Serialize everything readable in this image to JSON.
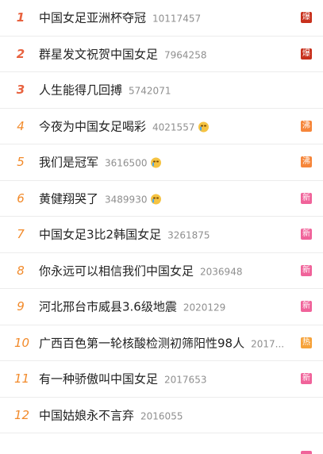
{
  "colors": {
    "top_rank": "#e8623f",
    "rank": "#f28a2a",
    "badge_bao": "#c8311d",
    "badge_fei": "#f6863a",
    "badge_xin": "#f0639a",
    "badge_re": "#f6a23a"
  },
  "items": [
    {
      "rank": "1",
      "title": "中国女足亚洲杯夺冠",
      "count": "10117457",
      "emoji": false,
      "badge": "爆"
    },
    {
      "rank": "2",
      "title": "群星发文祝贺中国女足",
      "count": "7964258",
      "emoji": false,
      "badge": "爆"
    },
    {
      "rank": "3",
      "title": "人生能得几回搏",
      "count": "5742071",
      "emoji": false,
      "badge": ""
    },
    {
      "rank": "4",
      "title": "今夜为中国女足喝彩",
      "count": "4021557",
      "emoji": true,
      "badge": "沸"
    },
    {
      "rank": "5",
      "title": "我们是冠军",
      "count": "3616500",
      "emoji": true,
      "badge": "沸"
    },
    {
      "rank": "6",
      "title": "黄健翔哭了",
      "count": "3489930",
      "emoji": true,
      "badge": "新"
    },
    {
      "rank": "7",
      "title": "中国女足3比2韩国女足",
      "count": "3261875",
      "emoji": false,
      "badge": "新"
    },
    {
      "rank": "8",
      "title": "你永远可以相信我们中国女足",
      "count": "2036948",
      "emoji": false,
      "badge": "新"
    },
    {
      "rank": "9",
      "title": "河北邢台市威县3.6级地震",
      "count": "2020129",
      "emoji": false,
      "badge": "新"
    },
    {
      "rank": "10",
      "title": "广西百色第一轮核酸检测初筛阳性98人",
      "count": "2017...",
      "emoji": false,
      "badge": "热"
    },
    {
      "rank": "11",
      "title": "有一种骄傲叫中国女足",
      "count": "2017653",
      "emoji": false,
      "badge": "新"
    },
    {
      "rank": "12",
      "title": "中国姑娘永不言弃",
      "count": "2016055",
      "emoji": false,
      "badge": ""
    }
  ]
}
